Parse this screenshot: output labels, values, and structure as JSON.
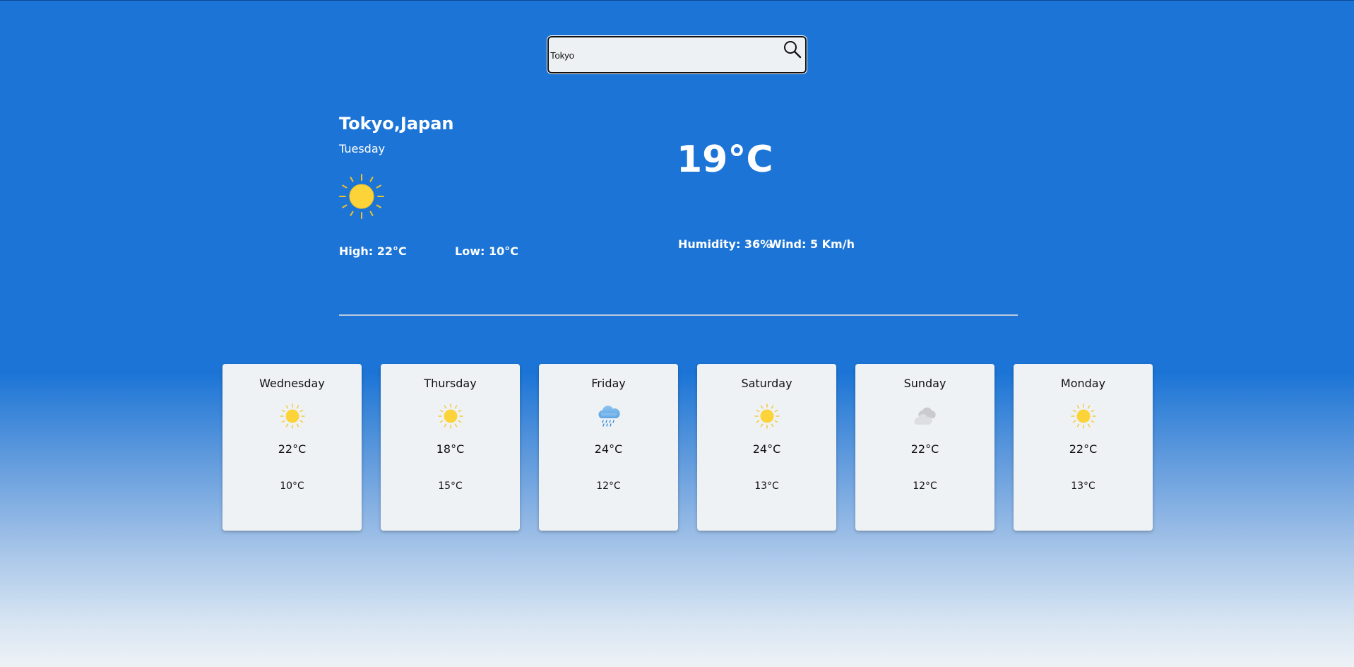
{
  "search": {
    "value": "Tokyo",
    "placeholder": ""
  },
  "current": {
    "location": "Tokyo,Japan",
    "day": "Tuesday",
    "icon": "sun-icon",
    "temperature": "19°C",
    "high": "High: 22°C",
    "low": "Low: 10°C",
    "humidity": "Humidity: 36%",
    "wind": "Wind: 5 Km/h"
  },
  "forecast": [
    {
      "day": "Wednesday",
      "icon": "sun-icon",
      "high": "22°C",
      "low": "10°C"
    },
    {
      "day": "Thursday",
      "icon": "sun-icon",
      "high": "18°C",
      "low": "15°C"
    },
    {
      "day": "Friday",
      "icon": "rain-cloud-icon",
      "high": "24°C",
      "low": "12°C"
    },
    {
      "day": "Saturday",
      "icon": "sun-icon",
      "high": "24°C",
      "low": "13°C"
    },
    {
      "day": "Sunday",
      "icon": "cloud-icon",
      "high": "22°C",
      "low": "12°C"
    },
    {
      "day": "Monday",
      "icon": "sun-icon",
      "high": "22°C",
      "low": "13°C"
    }
  ],
  "colors": {
    "background": "#1c75d6",
    "card": "#eff2f5",
    "sun": "#fdd33a",
    "sun_rays": "#f3c224",
    "rain": "#3a8fd8",
    "cloud": "#d6d8db"
  }
}
